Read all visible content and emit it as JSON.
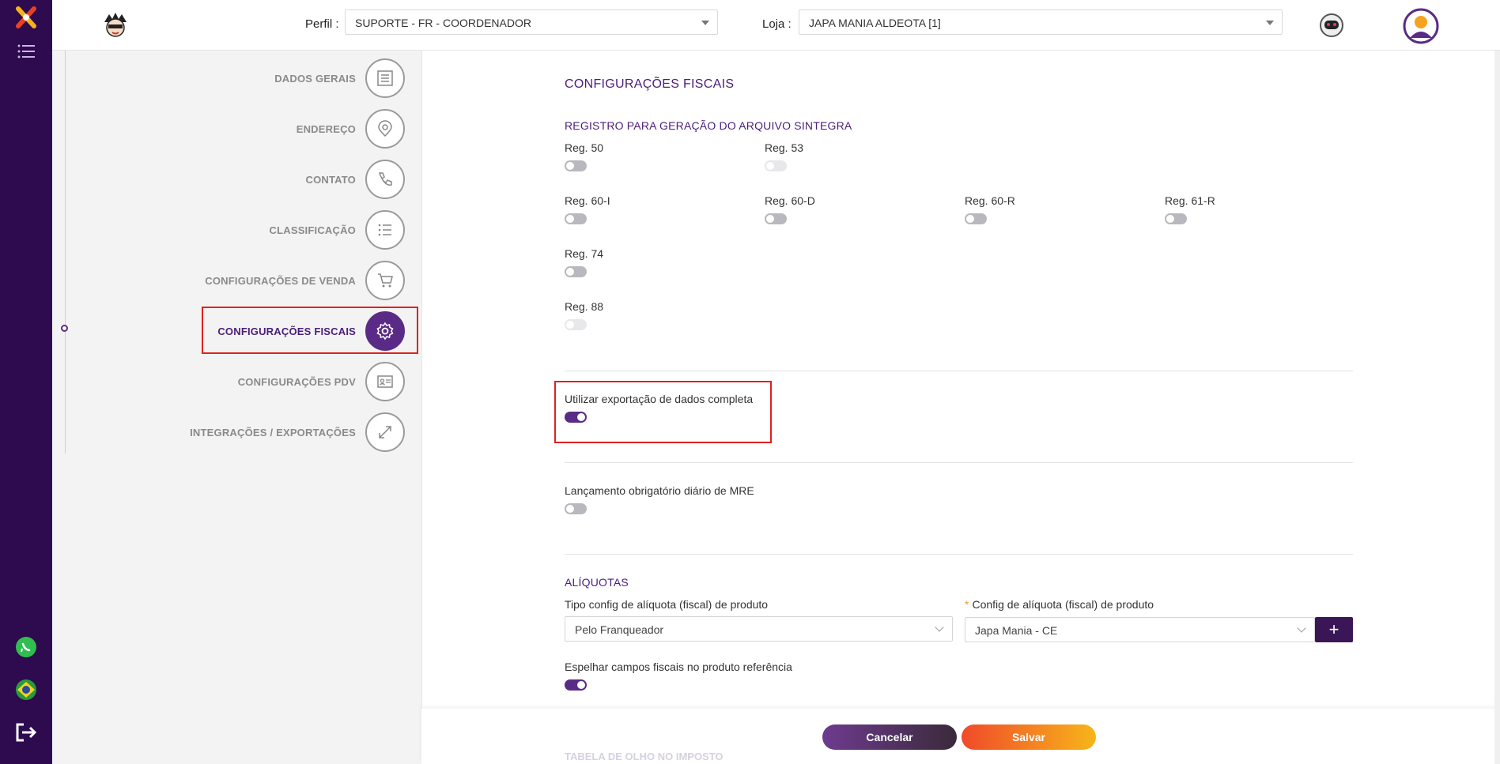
{
  "header": {
    "perfil_label": "Perfil :",
    "perfil_value": "SUPORTE - FR - COORDENADOR",
    "loja_label": "Loja :",
    "loja_value": "JAPA MANIA ALDEOTA [1]"
  },
  "nav": [
    {
      "label": "DADOS GERAIS",
      "icon": "list-icon"
    },
    {
      "label": "ENDEREÇO",
      "icon": "location-pin-icon"
    },
    {
      "label": "CONTATO",
      "icon": "phone-icon"
    },
    {
      "label": "CLASSIFICAÇÃO",
      "icon": "bullet-list-icon"
    },
    {
      "label": "CONFIGURAÇÕES DE VENDA",
      "icon": "cart-icon"
    },
    {
      "label": "CONFIGURAÇÕES FISCAIS",
      "icon": "gear-icon",
      "active": true
    },
    {
      "label": "CONFIGURAÇÕES PDV",
      "icon": "id-card-icon"
    },
    {
      "label": "INTEGRAÇÕES / EXPORTAÇÕES",
      "icon": "expand-icon"
    }
  ],
  "main": {
    "title": "CONFIGURAÇÕES FISCAIS",
    "sintegra_title": "REGISTRO PARA GERAÇÃO DO ARQUIVO SINTEGRA",
    "regs": [
      {
        "label": "Reg. 50",
        "state": "off"
      },
      {
        "label": "Reg. 53",
        "state": "disabled"
      },
      {
        "label": "Reg. 60-I",
        "state": "off"
      },
      {
        "label": "Reg. 60-D",
        "state": "off"
      },
      {
        "label": "Reg. 60-R",
        "state": "off"
      },
      {
        "label": "Reg. 61-R",
        "state": "off"
      },
      {
        "label": "Reg. 74",
        "state": "off"
      },
      {
        "label": "Reg. 88",
        "state": "disabled"
      }
    ],
    "export_label": "Utilizar exportação de dados completa",
    "export_on": true,
    "mre_label": "Lançamento obrigatório diário de MRE",
    "mre_on": false,
    "aliquotas_title": "ALÍQUOTAS",
    "tipo_label": "Tipo config de alíquota (fiscal) de produto",
    "tipo_value": "Pelo Franqueador",
    "config_label": "Config de alíquota (fiscal) de produto",
    "config_value": "Japa Mania - CE",
    "plus_label": "+",
    "espelhar_label": "Espelhar campos fiscais no produto referência",
    "espelhar_on": true,
    "faded_title": "TABELA DE OLHO NO IMPOSTO"
  },
  "footer": {
    "cancel_label": "Cancelar",
    "save_label": "Salvar"
  },
  "colors": {
    "brand_purple": "#5a2b86",
    "rail": "#2e0a4e",
    "highlight_red": "#e0201f"
  }
}
